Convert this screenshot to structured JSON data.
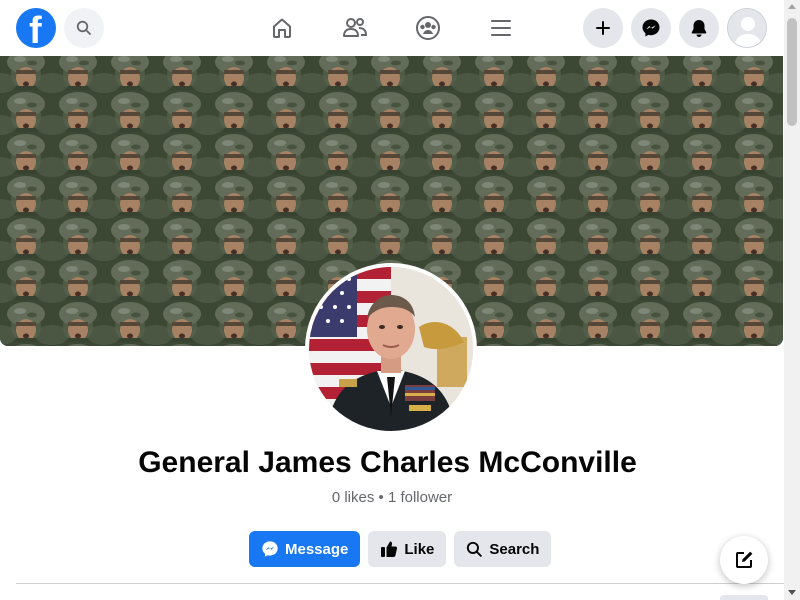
{
  "header": {
    "logo_letter": "f",
    "icons": {
      "logo": "facebook-logo-icon",
      "search": "search-icon",
      "home": "home-icon",
      "friends": "friends-icon",
      "groups": "groups-icon",
      "menu": "menu-icon",
      "create": "plus-icon",
      "messenger": "messenger-icon",
      "notifications": "bell-icon",
      "account": "avatar-icon"
    }
  },
  "page": {
    "name": "General James Charles McConville",
    "stats": "0 likes • 1 follower"
  },
  "actions": {
    "message_label": "Message",
    "like_label": "Like",
    "search_label": "Search"
  },
  "colors": {
    "brand": "#1877f2",
    "button_grey": "#e4e6eb",
    "text_primary": "#050505",
    "text_secondary": "#65676b"
  }
}
